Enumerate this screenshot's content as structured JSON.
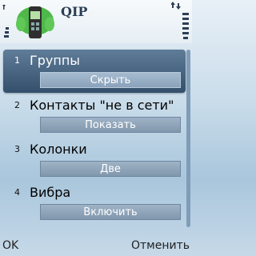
{
  "header": {
    "title": "QIP"
  },
  "items": [
    {
      "num": "1",
      "label": "Группы",
      "value": "Скрыть",
      "selected": true
    },
    {
      "num": "2",
      "label": "Контакты \"не в сети\"",
      "value": "Показать",
      "selected": false
    },
    {
      "num": "3",
      "label": "Колонки",
      "value": "Две",
      "selected": false
    },
    {
      "num": "4",
      "label": "Вибра",
      "value": "Включить",
      "selected": false
    }
  ],
  "softkeys": {
    "left": "OK",
    "right": "Отменить"
  },
  "colors": {
    "selection": "#334f6b",
    "value_button": "#8197ad",
    "logo_green": "#4fb84a"
  }
}
